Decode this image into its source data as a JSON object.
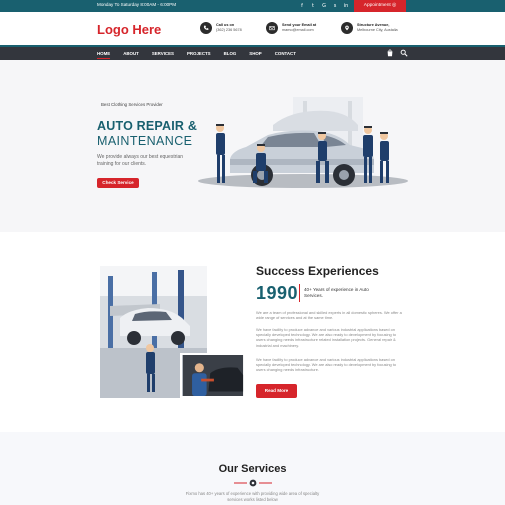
{
  "topbar": {
    "hours": "Monday To Saturday 8:00AM - 6:00PM",
    "social": [
      "f-icon",
      "twitter-icon",
      "google-plus-icon",
      "skype-icon",
      "linkedin-icon"
    ],
    "social_glyphs": [
      "f",
      "t",
      "G",
      "s",
      "in"
    ],
    "appointment_label": "Appointment ◎"
  },
  "header": {
    "logo": "Logo Here",
    "contacts": [
      {
        "label": "Call us on",
        "value": "(362) 236 5678"
      },
      {
        "label": "Send your Email at",
        "value": "mamo@email.com"
      },
      {
        "label": "Structure Avenue,",
        "value": "Melbourne City, Austalia"
      }
    ]
  },
  "nav": {
    "items": [
      "HOME",
      "ABOUT",
      "SERVICES",
      "PROJECTS",
      "BLOG",
      "SHOP",
      "CONTACT"
    ]
  },
  "hero": {
    "kicker": "Best Clothing Services Provider",
    "title_line1": "AUTO REPAIR &",
    "title_line2": "MAINTENANCE",
    "description": "We provide always our best equestrian training for our clients.",
    "cta": "Check Service",
    "prev_arrow": "‹",
    "next_arrow": "›"
  },
  "about": {
    "heading": "Success Experiences",
    "year": "1990",
    "experience": "40+ Years of experience in Auto Services.",
    "paragraphs": [
      "We are a team of professional and skilled experts in all domestic spheres. We offer a wide range of services and at the same time.",
      "We have facility to produce advance and various industrial applications based on specially developed technology. We are also ready to development by focusing to users changing needs infrastructure related installation projects. General repair & industrial and machinery.",
      "We have facility to produce advance and various industrial applications based on specially developed technology. We are also ready to development by focusing to users changing needs infrastructure."
    ],
    "read_more": "Read More"
  },
  "services": {
    "heading": "Our Services",
    "lead": "Fixmo has 40+ years of experience with providing wide area of specialty services works listed below"
  },
  "colors": {
    "brand_teal": "#19606f",
    "accent_red": "#d6252b",
    "nav_dark": "#33363d"
  }
}
